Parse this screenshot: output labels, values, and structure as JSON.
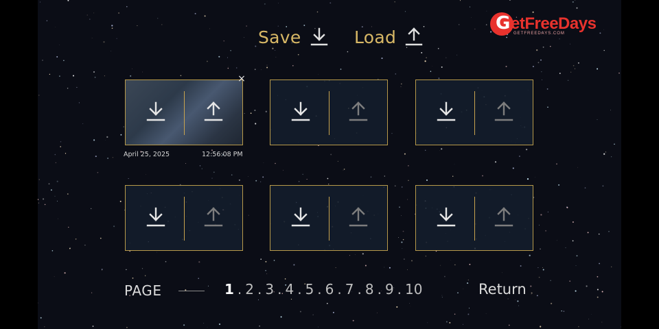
{
  "header": {
    "save_label": "Save",
    "load_label": "Load"
  },
  "colors": {
    "accent": "#d8b866",
    "slot_border": "#b89a4a",
    "text": "#dcdcdc",
    "logo_red": "#e8322d"
  },
  "slots": [
    {
      "filled": true,
      "date": "April 25, 2025",
      "time": "12:56:08 PM",
      "close_symbol": "×",
      "save_icon": "download-icon",
      "load_icon": "upload-icon"
    },
    {
      "filled": false
    },
    {
      "filled": false
    },
    {
      "filled": false
    },
    {
      "filled": false
    },
    {
      "filled": false
    }
  ],
  "footer": {
    "page_label": "PAGE",
    "pages": [
      "1",
      "2",
      "3",
      "4",
      "5",
      "6",
      "7",
      "8",
      "9",
      "10"
    ],
    "current_page": "1",
    "return_label": "Return"
  },
  "logo": {
    "text": "etFreeDays",
    "g": "G",
    "sub": "GETFREEDAYS.COM"
  }
}
